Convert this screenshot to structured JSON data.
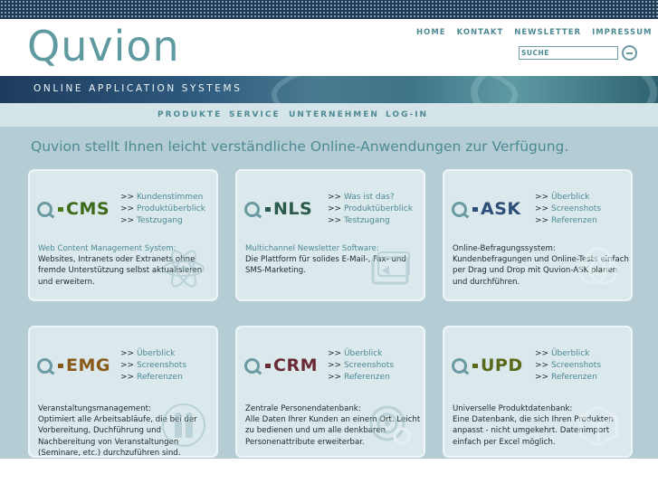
{
  "brand": {
    "logo_text": "Quvion",
    "tagline": "ONLINE APPLICATION SYSTEMS"
  },
  "topnav": [
    {
      "label": "HOME"
    },
    {
      "label": "KONTAKT"
    },
    {
      "label": "NEWSLETTER"
    },
    {
      "label": "IMPRESSUM"
    }
  ],
  "search": {
    "placeholder": "SUCHE"
  },
  "mainnav": [
    {
      "label": "PRODUKTE"
    },
    {
      "label": "SERVICE"
    },
    {
      "label": "UNTERNEHMEN"
    },
    {
      "label": "LOG-IN"
    }
  ],
  "headline": "Quvion stellt Ihnen leicht verständliche Online-Anwendungen zur Verfügung.",
  "link_prefix": ">>",
  "products": [
    {
      "name": "CMS",
      "color": "#3f6a1a",
      "links": [
        "Kundenstimmen",
        "Produktüberblick",
        "Testzugang"
      ],
      "subtitle": "Web Content Management System:",
      "description": "Websites, Intranets oder Extranets ohne fremde Unterstützung selbst aktualisieren und erweitern.",
      "watermark_icon": "atom-icon"
    },
    {
      "name": "NLS",
      "color": "#2a5a4a",
      "links": [
        "Was ist das?",
        "Produktüberblick",
        "Testzugang"
      ],
      "subtitle": "Multichannel Newsletter Software:",
      "description": "Die Plattform für solides E-Mail-, Fax- und SMS-Marketing.",
      "watermark_icon": "envelope-icon"
    },
    {
      "name": "ASK",
      "color": "#2e4f7a",
      "links": [
        "Überblick",
        "Screenshots",
        "Referenzen"
      ],
      "subtitle": "Online-Befragungssystem:",
      "description": "Kundenbefragungen und Online-Tests einfach per Drag und Drop mit Quvion-ASK planen und durchführen.",
      "watermark_icon": "venn-icon"
    },
    {
      "name": "EMG",
      "color": "#8a5a1a",
      "links": [
        "Überblick",
        "Screenshots",
        "Referenzen"
      ],
      "subtitle": "Veranstaltungsmanagement:",
      "description": "Optimiert alle Arbeitsabläufe, die bei der Vorbereitung, Duchführung und Nachbereitung von Veranstaltungen (Seminare, etc.) durchzuführen sind.",
      "watermark_icon": "people-icon"
    },
    {
      "name": "CRM",
      "color": "#6a2a35",
      "links": [
        "Überblick",
        "Screenshots",
        "Referenzen"
      ],
      "subtitle": "Zentrale Personendatenbank:",
      "description": "Alle Daten Ihrer Kunden an einem Ort. Leicht zu bedienen und um alle denkbaren Personenattribute erweiterbar.",
      "watermark_icon": "target-icon"
    },
    {
      "name": "UPD",
      "color": "#5a6a1a",
      "links": [
        "Überblick",
        "Screenshots",
        "Referenzen"
      ],
      "subtitle": "Universelle Produktdatenbank:",
      "description": "Eine Datenbank, die sich Ihren Produkten anpasst - nicht umgekehrt. Datenimport einfach per Excel möglich.",
      "watermark_icon": "cube-icon"
    }
  ]
}
